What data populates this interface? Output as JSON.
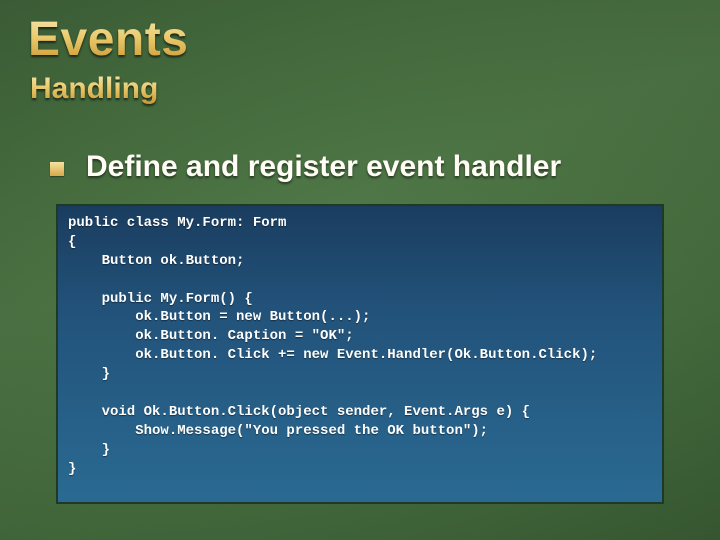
{
  "slide": {
    "title": "Events",
    "subtitle": "Handling",
    "bullet": "Define and register event handler",
    "code": "public class My.Form: Form\n{\n    Button ok.Button;\n\n    public My.Form() {\n        ok.Button = new Button(...);\n        ok.Button. Caption = \"OK\";\n        ok.Button. Click += new Event.Handler(Ok.Button.Click);\n    }\n\n    void Ok.Button.Click(object sender, Event.Args e) {\n        Show.Message(\"You pressed the OK button\");\n    }\n}"
  }
}
